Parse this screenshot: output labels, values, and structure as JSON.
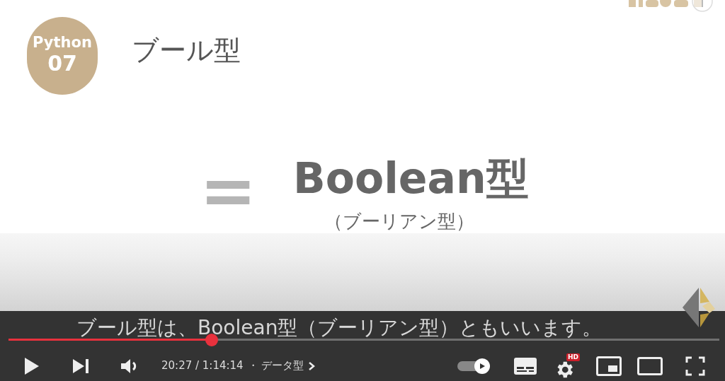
{
  "slide": {
    "badge_top": "Python",
    "badge_number": "07",
    "title": "ブール型",
    "symbol": "=",
    "term": "Boolean型",
    "reading": "（ブーリアン型）"
  },
  "caption": "ブール型は、Boolean型（ブーリアン型）ともいいます。",
  "progress": {
    "level": 0.286
  },
  "controls": {
    "time": "20:27 / 1:14:14",
    "separator": "・",
    "chapter": "データ型",
    "autoplay_on": true,
    "hd_badge": "HD"
  }
}
